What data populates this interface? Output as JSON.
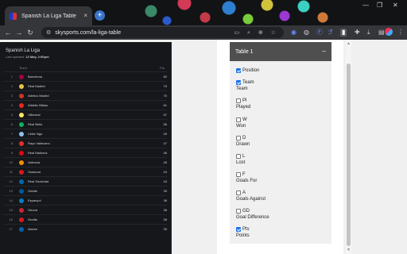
{
  "browser": {
    "tab_title": "Spanish La Liga Table",
    "tab_close": "×",
    "new_tab": "+",
    "url": "skysports.com/la-liga-table",
    "minimize": "—",
    "restore": "❐",
    "close": "✕"
  },
  "league": {
    "name": "Spanish La Liga",
    "updated_label": "Last updated: ",
    "updated_value": "12 May, 2:50pm",
    "col_team": "Team",
    "col_pts": "Pts",
    "rows": [
      {
        "pos": "1",
        "team": "Barcelona",
        "pts": "82",
        "color": "#a50044"
      },
      {
        "pos": "2",
        "team": "Real Madrid",
        "pts": "75",
        "color": "#e8c547"
      },
      {
        "pos": "3",
        "team": "Atletico Madrid",
        "pts": "70",
        "color": "#cb3524"
      },
      {
        "pos": "4",
        "team": "Athletic Bilbao",
        "pts": "61",
        "color": "#ee2523"
      },
      {
        "pos": "5",
        "team": "Villarreal",
        "pts": "57",
        "color": "#ffe667"
      },
      {
        "pos": "6",
        "team": "Real Betis",
        "pts": "56",
        "color": "#0bb363"
      },
      {
        "pos": "7",
        "team": "Celta Vigo",
        "pts": "49",
        "color": "#8ac3ee"
      },
      {
        "pos": "8",
        "team": "Rayo Vallecano",
        "pts": "47",
        "color": "#e53027"
      },
      {
        "pos": "9",
        "team": "Real Mallorca",
        "pts": "46",
        "color": "#e20613"
      },
      {
        "pos": "10",
        "team": "Valencia",
        "pts": "45",
        "color": "#f18e00"
      },
      {
        "pos": "11",
        "team": "Osasuna",
        "pts": "44",
        "color": "#d91a21"
      },
      {
        "pos": "12",
        "team": "Real Sociedad",
        "pts": "43",
        "color": "#0067b1"
      },
      {
        "pos": "13",
        "team": "Getafe",
        "pts": "39",
        "color": "#005999"
      },
      {
        "pos": "14",
        "team": "Espanyol",
        "pts": "38",
        "color": "#007fc8"
      },
      {
        "pos": "15",
        "team": "Girona",
        "pts": "38",
        "color": "#cd2534"
      },
      {
        "pos": "16",
        "team": "Sevilla",
        "pts": "38",
        "color": "#d71920"
      },
      {
        "pos": "17",
        "team": "Alaves",
        "pts": "35",
        "color": "#0761af"
      }
    ]
  },
  "table_card": {
    "title": "Table 1",
    "collapse": "–",
    "options": [
      {
        "checked": true,
        "short": "Position",
        "label": ""
      },
      {
        "checked": true,
        "short": "Team",
        "label": "Team"
      },
      {
        "checked": false,
        "short": "Pl",
        "label": "Played"
      },
      {
        "checked": false,
        "short": "W",
        "label": "Won"
      },
      {
        "checked": false,
        "short": "D",
        "label": "Drawn"
      },
      {
        "checked": false,
        "short": "L",
        "label": "Lost"
      },
      {
        "checked": false,
        "short": "F",
        "label": "Goals For"
      },
      {
        "checked": false,
        "short": "A",
        "label": "Goals Against"
      },
      {
        "checked": false,
        "short": "GD",
        "label": "Goal Difference"
      },
      {
        "checked": true,
        "short": "Pts",
        "label": "Points"
      }
    ]
  }
}
